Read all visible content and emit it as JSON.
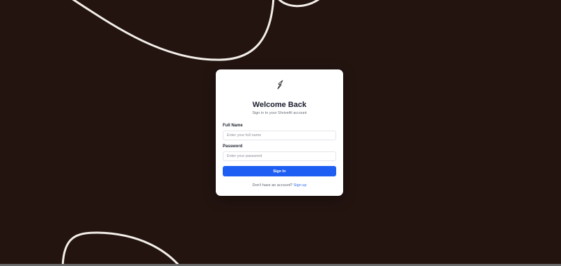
{
  "colors": {
    "background": "#231410",
    "card": "#ffffff",
    "accent": "#1e5ef3",
    "link": "#2f6bf0",
    "heading": "#1a1d2e"
  },
  "logo": {
    "icon": "leaf-brand-icon"
  },
  "login": {
    "title": "Welcome Back",
    "subtitle": "Sign in to your ShriveAI account",
    "full_name_label": "Full Name",
    "full_name_placeholder": "Enter your full name",
    "full_name_value": "",
    "password_label": "Password",
    "password_placeholder": "Enter your password",
    "password_value": "",
    "submit_label": "Sign In",
    "footer_text": "Don't have an account?",
    "signup_link": "Sign up"
  }
}
